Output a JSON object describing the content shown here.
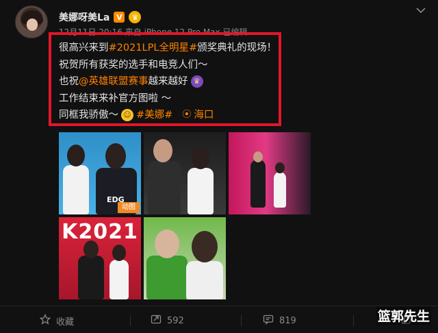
{
  "post": {
    "username": "美娜呀美La",
    "verified_badge": "V",
    "meta": "12月11日 20:16 来自 iPhone 12 Pro Max 已编辑",
    "lines": [
      {
        "before": "很高兴来到",
        "topic": "#2021LPL全明星#",
        "after": " 颁奖典礼的现场！"
      },
      {
        "text": "祝贺所有获奖的选手和电竞人们～"
      },
      {
        "before": "也祝",
        "mention": "@英雄联盟赛事",
        "after": " 越来越好"
      },
      {
        "text": "工作结束来补官方图啦 ～"
      },
      {
        "before": "同框我骄傲～",
        "topic": "#美娜#",
        "location": "海口"
      }
    ]
  },
  "photos": {
    "gif_tag": "动图",
    "jersey_text": "EDG",
    "stage_text": "K2021"
  },
  "actions": {
    "favorite_label": "收藏",
    "repost_count": "592",
    "comment_count": "819"
  },
  "watermark": "篮郭先生",
  "colors": {
    "accent": "#ff8200",
    "highlight_border": "#e3162a",
    "background": "#111111"
  },
  "icons": [
    "more-icon",
    "favorite-icon",
    "repost-icon",
    "comment-icon",
    "like-icon",
    "location-icon"
  ]
}
